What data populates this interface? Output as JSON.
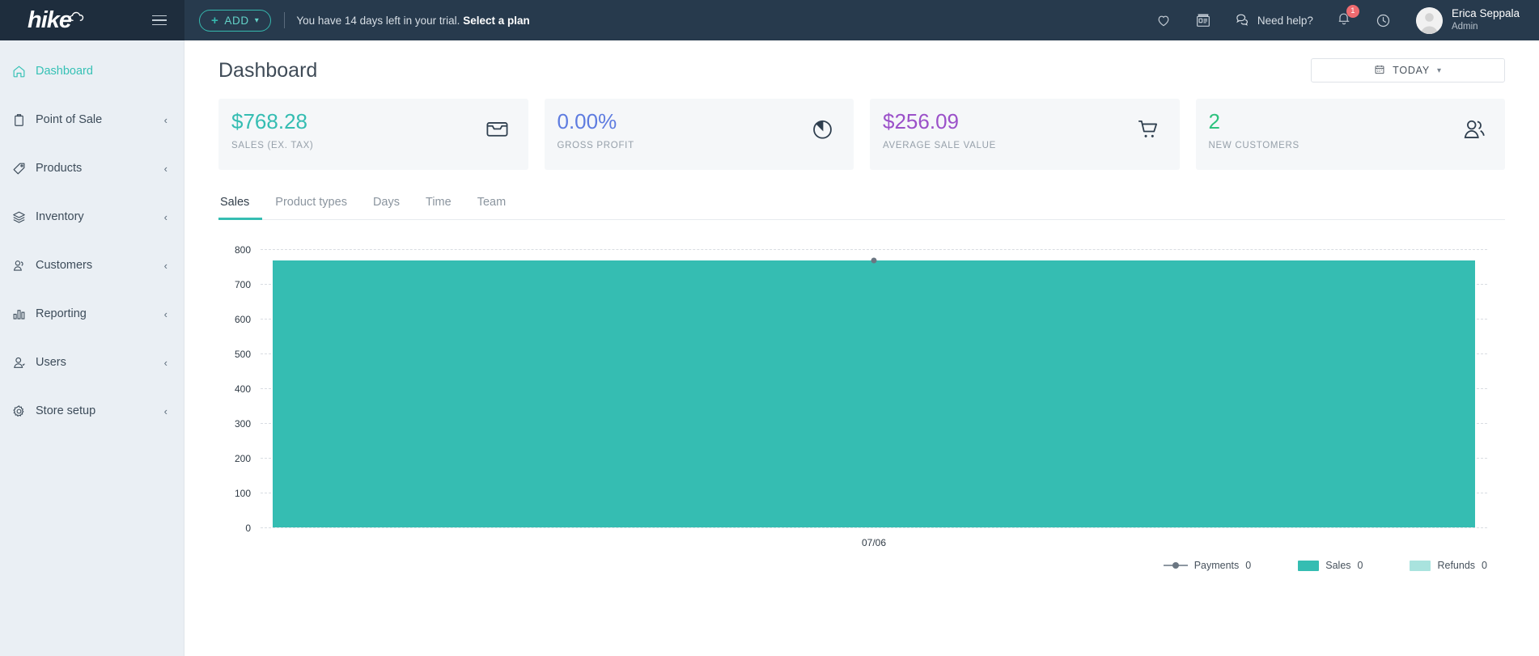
{
  "brand": {
    "logo_text": "hike",
    "logo_icon": "cloud-icon",
    "menu_icon": "hamburger-icon"
  },
  "topbar": {
    "add_label": "ADD",
    "add_icon": "plus-icon",
    "add_caret_icon": "chevron-down-icon",
    "trial_text": "You have 14 days left in your trial.",
    "trial_link": "Select a plan",
    "heart_icon": "heart-icon",
    "news_icon": "news-card-icon",
    "need_help_label": "Need help?",
    "chat_icon": "chat-bubble-icon",
    "bell_icon": "bell-icon",
    "bell_badge": "1",
    "history_icon": "clock-icon",
    "avatar_icon": "avatar-icon",
    "user_name": "Erica Seppala",
    "user_role": "Admin"
  },
  "sidebar": {
    "items": [
      {
        "label": "Dashboard",
        "icon": "home-icon",
        "active": true,
        "expandable": false
      },
      {
        "label": "Point of Sale",
        "icon": "bag-icon",
        "active": false,
        "expandable": true
      },
      {
        "label": "Products",
        "icon": "tag-icon",
        "active": false,
        "expandable": true
      },
      {
        "label": "Inventory",
        "icon": "layers-icon",
        "active": false,
        "expandable": true
      },
      {
        "label": "Customers",
        "icon": "customers-icon",
        "active": false,
        "expandable": true
      },
      {
        "label": "Reporting",
        "icon": "bar-chart-icon",
        "active": false,
        "expandable": true
      },
      {
        "label": "Users",
        "icon": "user-check-icon",
        "active": false,
        "expandable": true
      },
      {
        "label": "Store setup",
        "icon": "gear-icon",
        "active": false,
        "expandable": true
      }
    ],
    "chevron_icon": "chevron-left-icon"
  },
  "page": {
    "title": "Dashboard",
    "date_filter": "TODAY",
    "date_filter_icon": "calendar-icon",
    "date_filter_caret": "chevron-down-icon"
  },
  "kpis": [
    {
      "value": "$768.28",
      "label": "SALES (EX. TAX)",
      "color": "#35bdb2",
      "icon": "tray-icon"
    },
    {
      "value": "0.00%",
      "label": "GROSS PROFIT",
      "color": "#5e7ce0",
      "icon": "pie-chart-icon"
    },
    {
      "value": "$256.09",
      "label": "AVERAGE SALE VALUE",
      "color": "#9b51c9",
      "icon": "cart-icon"
    },
    {
      "value": "2",
      "label": "NEW CUSTOMERS",
      "color": "#2ec27e",
      "icon": "people-icon"
    }
  ],
  "tabs": [
    {
      "label": "Sales",
      "active": true
    },
    {
      "label": "Product types",
      "active": false
    },
    {
      "label": "Days",
      "active": false
    },
    {
      "label": "Time",
      "active": false
    },
    {
      "label": "Team",
      "active": false
    }
  ],
  "chart_data": {
    "type": "bar",
    "title": "",
    "xlabel": "",
    "ylabel": "",
    "categories": [
      "07/06"
    ],
    "ylim": [
      0,
      800
    ],
    "yticks": [
      0,
      100,
      200,
      300,
      400,
      500,
      600,
      700,
      800
    ],
    "grid": true,
    "legend_position": "bottom-right",
    "series": [
      {
        "name": "Payments",
        "type": "line",
        "values": [
          768.28
        ],
        "legend_value": "0",
        "color": "#8d97a1"
      },
      {
        "name": "Sales",
        "type": "bar",
        "values": [
          768.28
        ],
        "legend_value": "0",
        "color": "#35bdb2"
      },
      {
        "name": "Refunds",
        "type": "bar",
        "values": [
          0
        ],
        "legend_value": "0",
        "color": "#a9e3de"
      }
    ]
  }
}
